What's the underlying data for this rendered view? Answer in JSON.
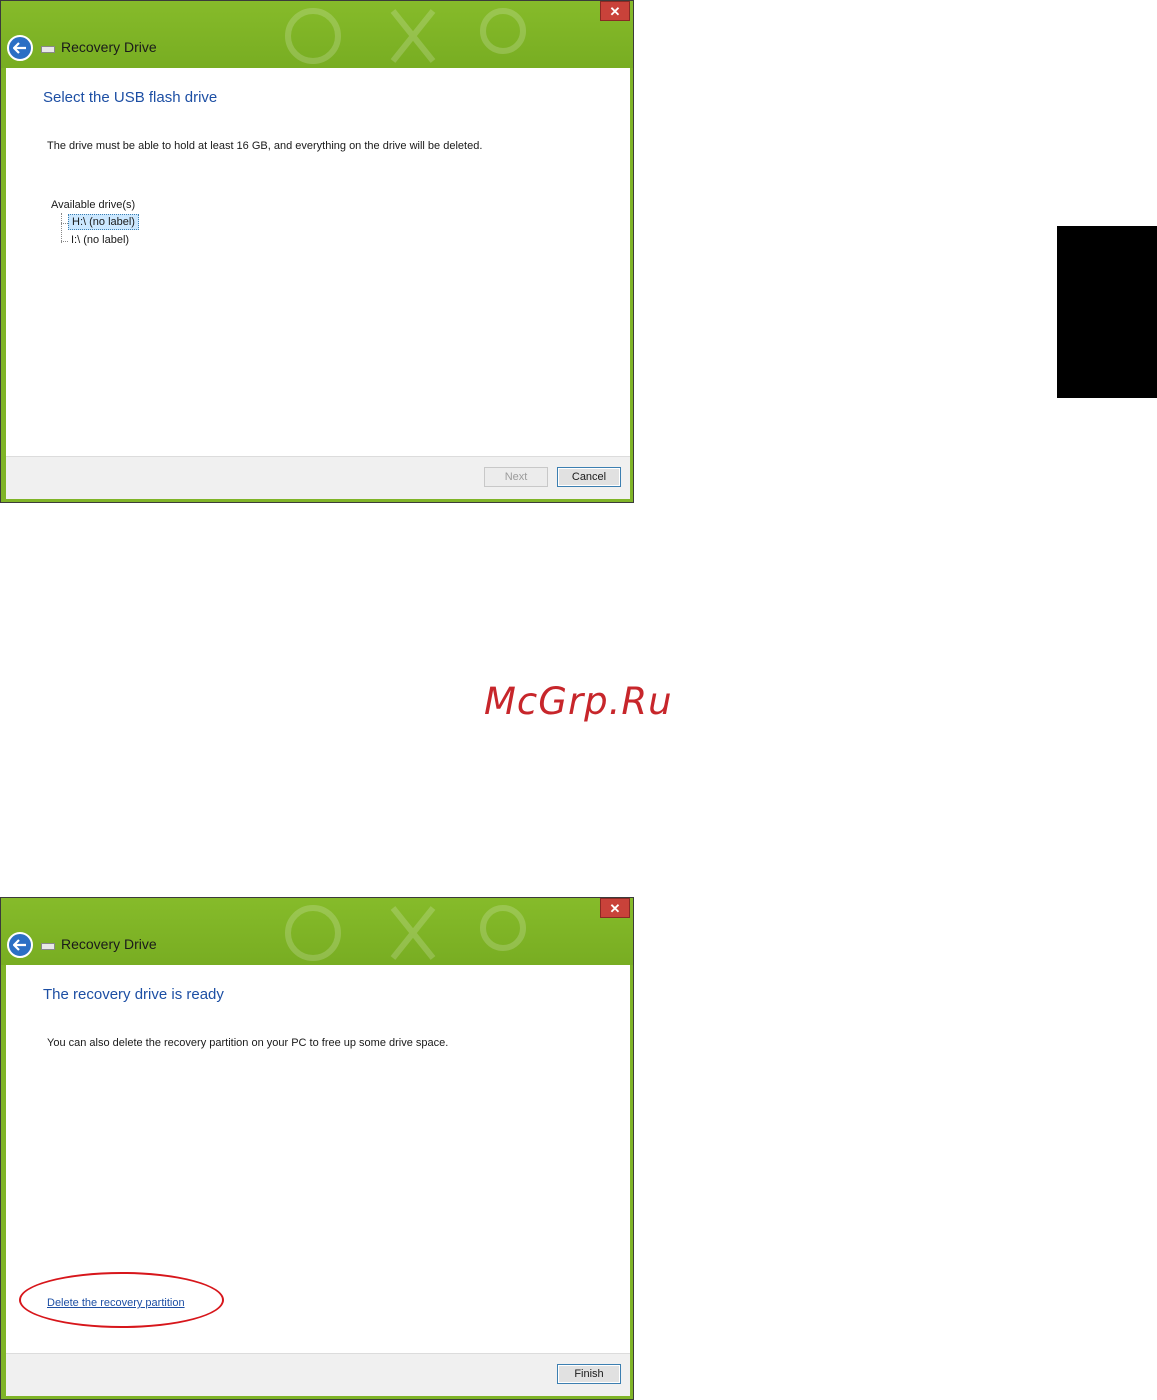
{
  "window1": {
    "title": "Recovery Drive",
    "close_label": "✕",
    "heading": "Select the USB flash drive",
    "description": "The drive must be able to hold at least 16 GB, and everything on the drive will be deleted.",
    "available_label": "Available drive(s)",
    "drives": [
      "H:\\ (no label)",
      "I:\\ (no label)"
    ],
    "next_label": "Next",
    "cancel_label": "Cancel"
  },
  "window2": {
    "title": "Recovery Drive",
    "close_label": "✕",
    "heading": "The recovery drive is ready",
    "description": "You can also delete the recovery partition on your PC to free up some drive space.",
    "link_label": "Delete the recovery partition",
    "finish_label": "Finish"
  },
  "watermark": "McGrp.Ru",
  "colors": {
    "titlebar": "#7fb427",
    "heading": "#1d4fa4",
    "highlight_ellipse": "#d7161b",
    "watermark": "#c7262b"
  }
}
